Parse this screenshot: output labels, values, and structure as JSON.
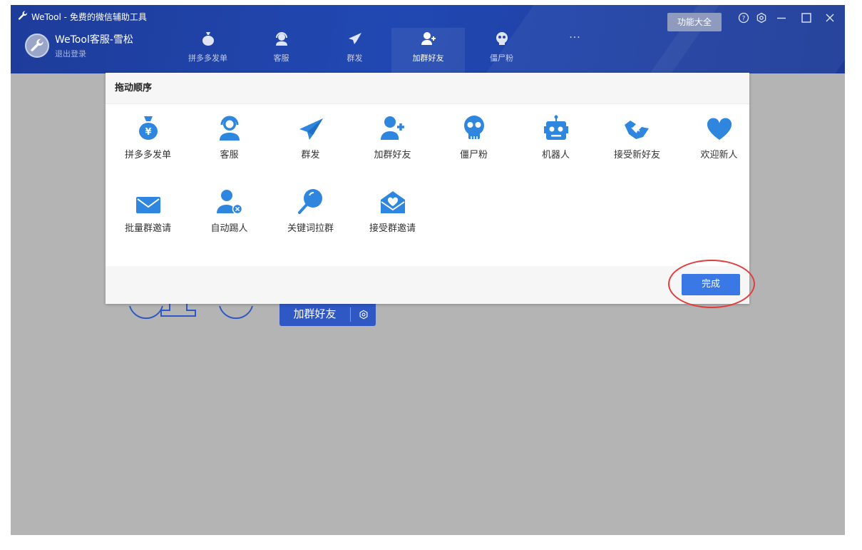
{
  "app": {
    "title": "WeTool - 免费的微信辅助工具"
  },
  "user": {
    "name": "WeTool客服-雪松",
    "logout": "退出登录"
  },
  "nav": {
    "items": [
      {
        "label": "拼多多发单",
        "icon": "money-bag-icon"
      },
      {
        "label": "客服",
        "icon": "headset-icon"
      },
      {
        "label": "群发",
        "icon": "paper-plane-icon"
      },
      {
        "label": "加群好友",
        "icon": "add-user-icon",
        "active": true
      },
      {
        "label": "僵尸粉",
        "icon": "skull-icon"
      }
    ],
    "more": "···"
  },
  "toolbar": {
    "feature_label": "功能大全"
  },
  "modal": {
    "title": "拖动顺序",
    "tiles": [
      {
        "label": "拼多多发单",
        "icon": "money-bag-icon"
      },
      {
        "label": "客服",
        "icon": "headset-icon"
      },
      {
        "label": "群发",
        "icon": "paper-plane-icon"
      },
      {
        "label": "加群好友",
        "icon": "add-user-icon"
      },
      {
        "label": "僵尸粉",
        "icon": "skull-icon"
      },
      {
        "label": "机器人",
        "icon": "robot-icon"
      },
      {
        "label": "接受新好友",
        "icon": "handshake-icon"
      },
      {
        "label": "欢迎新人",
        "icon": "heart-icon"
      },
      {
        "label": "批量群邀请",
        "icon": "envelope-icon"
      },
      {
        "label": "自动踢人",
        "icon": "remove-user-icon"
      },
      {
        "label": "关键词拉群",
        "icon": "search-icon"
      },
      {
        "label": "接受群邀请",
        "icon": "heart-envelope-icon"
      }
    ],
    "done_label": "完成"
  },
  "background": {
    "button_label": "加群好友"
  },
  "colors": {
    "header": "#2148b2",
    "accent": "#3a78e6",
    "icon_blue": "#2f86df",
    "overlay": "#b4b4b4",
    "highlight_circle": "#e23c3c"
  }
}
